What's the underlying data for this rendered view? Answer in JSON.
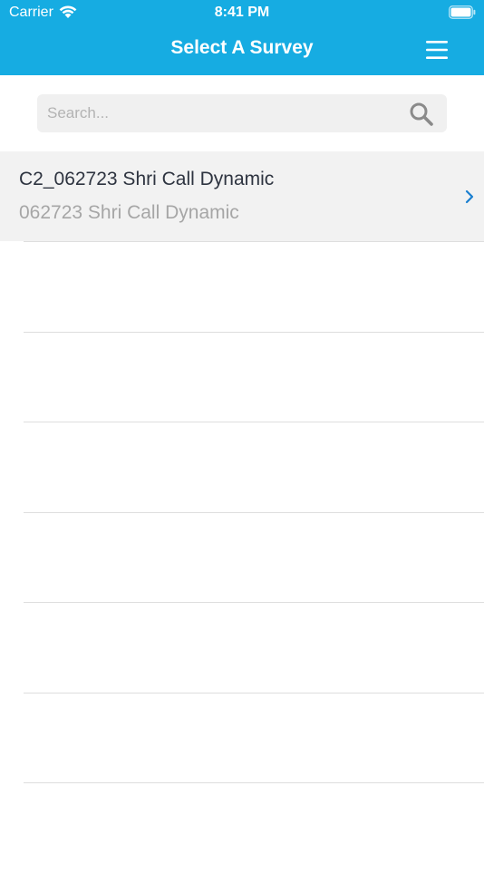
{
  "status_bar": {
    "carrier": "Carrier",
    "time": "8:41 PM"
  },
  "nav": {
    "title": "Select A Survey"
  },
  "search": {
    "placeholder": "Search..."
  },
  "surveys": [
    {
      "title": "C2_062723 Shri Call Dynamic",
      "subtitle": "062723 Shri Call Dynamic"
    }
  ],
  "colors": {
    "header": "#16ace2",
    "row_selected_bg": "#f2f2f2",
    "chevron": "#1a7fd0"
  }
}
